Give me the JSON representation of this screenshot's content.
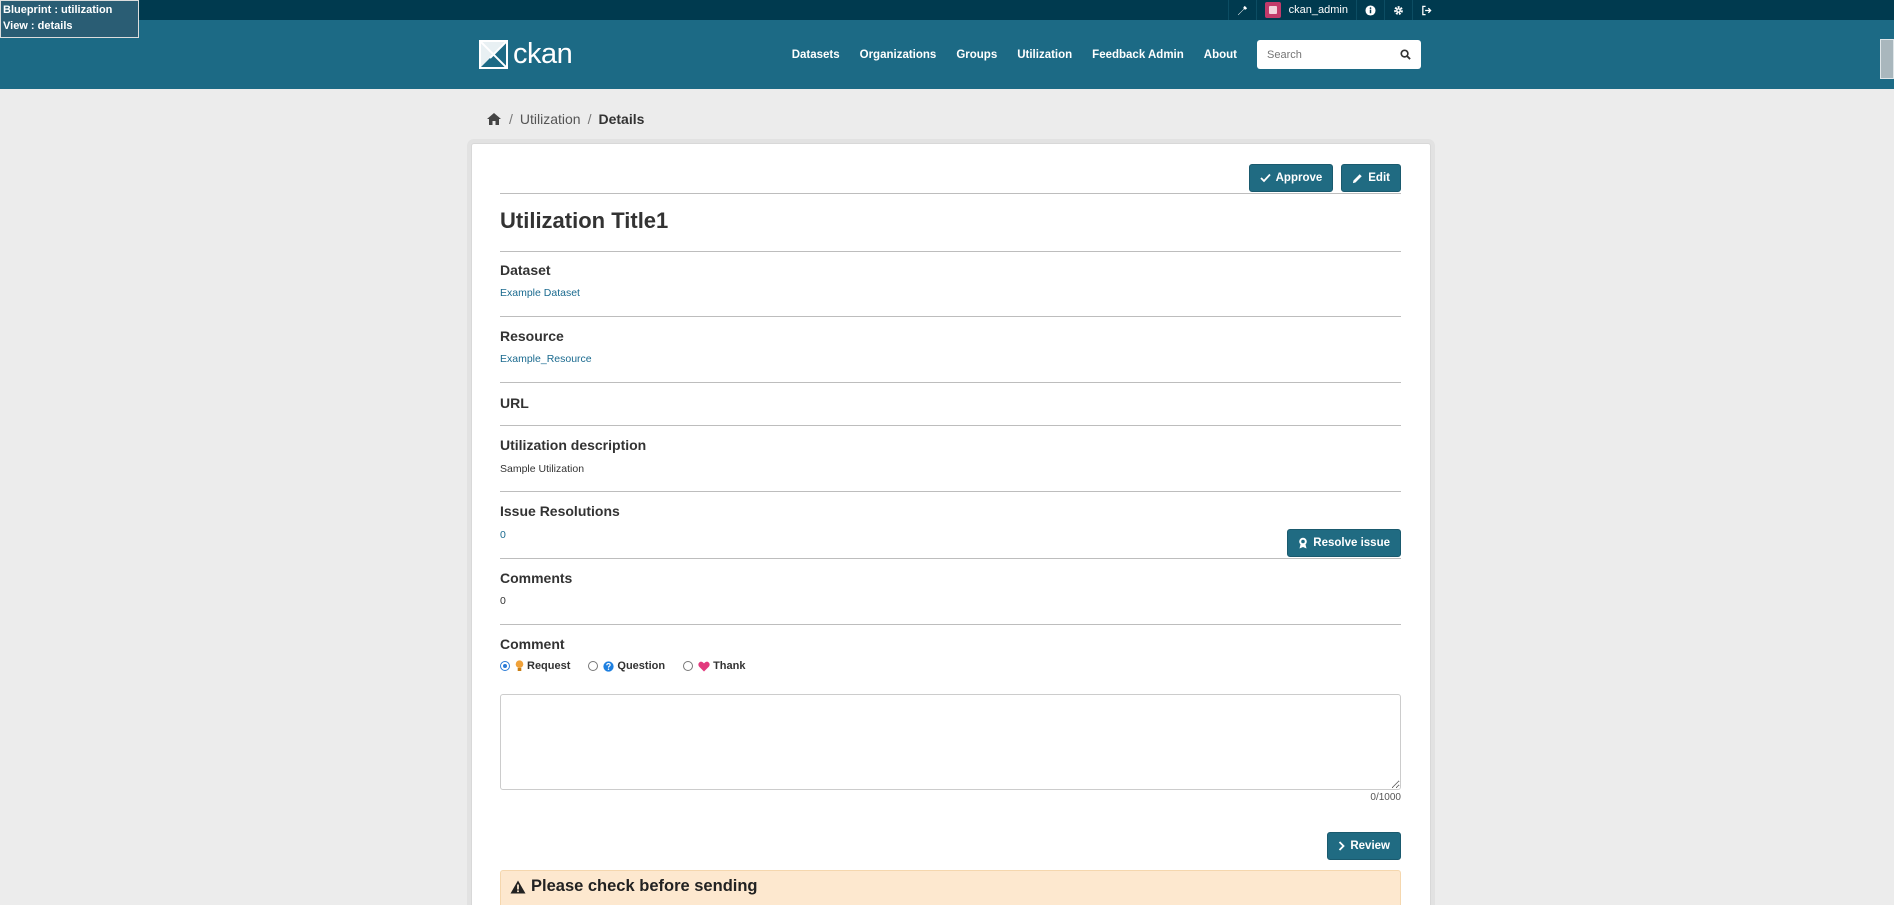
{
  "debug": {
    "blueprint": "Blueprint : utilization",
    "view": "View : details"
  },
  "account": {
    "username": "ckan_admin"
  },
  "site": {
    "logo_text": "ckan"
  },
  "nav": {
    "items": [
      "Datasets",
      "Organizations",
      "Groups",
      "Utilization",
      "Feedback Admin",
      "About"
    ]
  },
  "search": {
    "placeholder": "Search"
  },
  "breadcrumb": {
    "items": [
      "Utilization",
      "Details"
    ]
  },
  "actions": {
    "approve_label": "Approve",
    "edit_label": "Edit"
  },
  "page": {
    "title": "Utilization Title1"
  },
  "sections": {
    "dataset_label": "Dataset",
    "dataset_value": "Example Dataset",
    "resource_label": "Resource",
    "resource_value": "Example_Resource",
    "url_label": "URL",
    "description_label": "Utilization description",
    "description_value": "Sample Utilization",
    "issue_label": "Issue Resolutions",
    "issue_value": "0",
    "resolve_label": "Resolve issue",
    "comments_label": "Comments",
    "comments_value": "0"
  },
  "comment_form": {
    "label": "Comment",
    "options": [
      "Request",
      "Question",
      "Thank"
    ],
    "selected": "Request",
    "counter": "0/1000",
    "review_label": "Review"
  },
  "alert": {
    "title": "Please check before sending"
  },
  "colors": {
    "masthead": "#1c6a85",
    "account_bar": "#003a4f",
    "primary_button": "#206b82",
    "link": "#1a6a8f",
    "alert_bg": "#fde8cf"
  }
}
